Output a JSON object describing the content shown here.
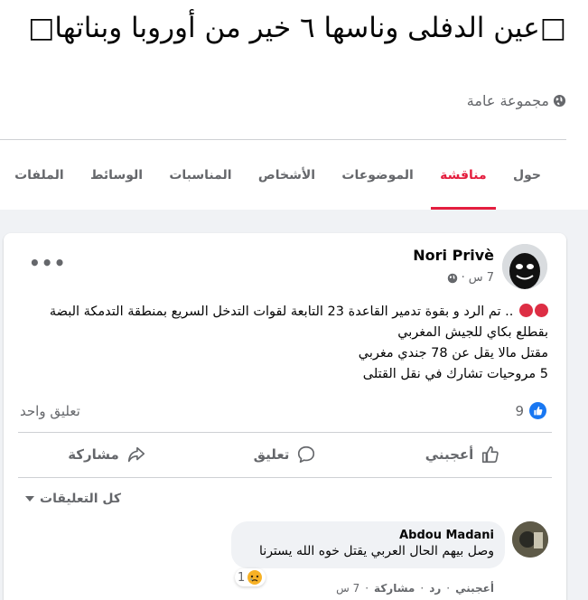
{
  "group": {
    "title": "□عين الدفلى وناسها ٦ خير من أوروبا وبناتها□",
    "privacy": "مجموعة عامة"
  },
  "tabs": [
    {
      "label": "حول",
      "active": false
    },
    {
      "label": "مناقشة",
      "active": true
    },
    {
      "label": "الموضوعات",
      "active": false
    },
    {
      "label": "الأشخاص",
      "active": false
    },
    {
      "label": "المناسبات",
      "active": false
    },
    {
      "label": "الوسائط",
      "active": false
    },
    {
      "label": "الملفات",
      "active": false
    }
  ],
  "post": {
    "author": "Nori Privè",
    "time": "7 س",
    "separator": "·",
    "lines": [
      ".. تم الرد و بقوة تدمير القاعدة 23 التابعة لقوات التدخل السريع بمنطقة التدمكة البضة",
      "بقطلع بكاي للجيش المغربي",
      "مقتل مالا يقل عن 78 جندي مغربي",
      "5 مروحيات تشارك في نقل القتلى"
    ],
    "reaction_count": "9",
    "comment_count": "تعليق واحد",
    "actions": {
      "like": "أعجبني",
      "comment": "تعليق",
      "share": "مشاركة"
    },
    "all_comments": "كل التعليقات"
  },
  "comment": {
    "author": "Abdou Madani",
    "text": "وصل بيهم الحال العربي يقتل خوه الله يسترنا",
    "reaction_count": "1",
    "like": "أعجبني",
    "reply": "رد",
    "share": "مشاركة",
    "time": "7 س",
    "sep": "·"
  },
  "colors": {
    "accent": "#e41e3f",
    "like_blue": "#1877f2",
    "muted": "#65676b",
    "red_dot": "#dd2e44"
  }
}
